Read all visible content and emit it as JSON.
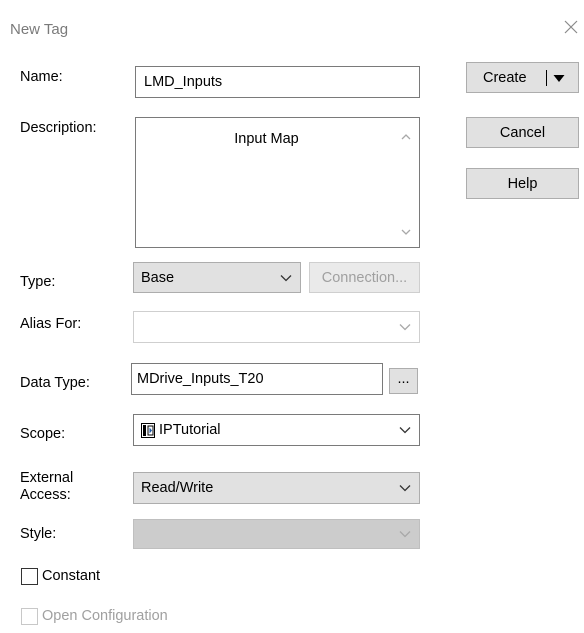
{
  "window": {
    "title": "New Tag"
  },
  "labels": {
    "name": "Name:",
    "description": "Description:",
    "type": "Type:",
    "alias_for": "Alias For:",
    "data_type": "Data Type:",
    "scope": "Scope:",
    "external_access": "External Access:",
    "style": "Style:"
  },
  "fields": {
    "name_value": "LMD_Inputs",
    "description_value": "Input Map",
    "type_value": "Base",
    "alias_for_value": "",
    "data_type_value": "MDrive_Inputs_T20",
    "data_type_browse_label": "...",
    "scope_value": "IPTutorial",
    "scope_icon": "controller-icon",
    "external_access_value": "Read/Write",
    "style_value": ""
  },
  "buttons": {
    "create": "Create",
    "cancel": "Cancel",
    "help": "Help",
    "connection": "Connection..."
  },
  "checkboxes": {
    "constant": {
      "label": "Constant",
      "checked": false,
      "enabled": true
    },
    "open_configuration": {
      "label": "Open Configuration",
      "checked": false,
      "enabled": false
    }
  }
}
